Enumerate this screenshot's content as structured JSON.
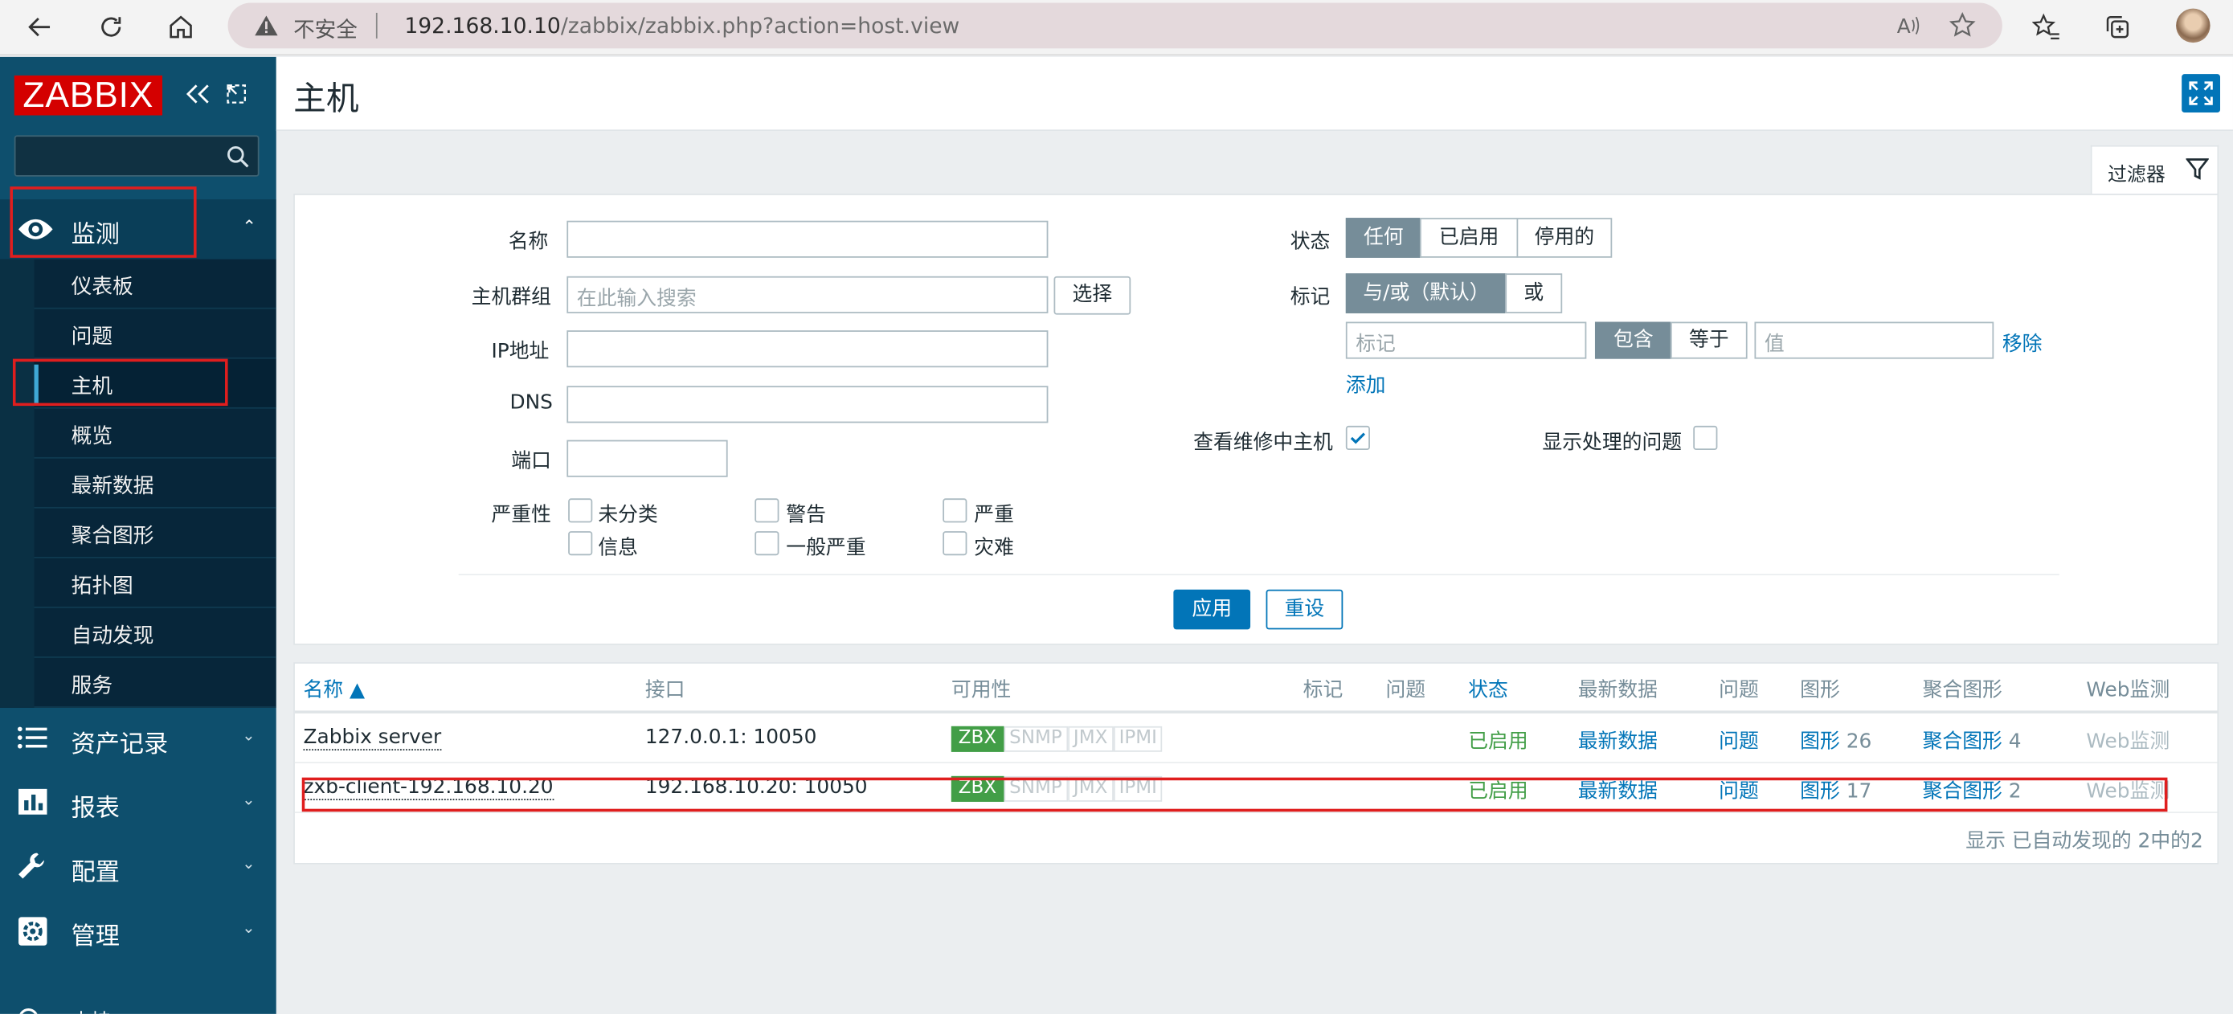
{
  "browser": {
    "insecure_label": "不安全",
    "url_host": "192.168.10.10",
    "url_path": "/zabbix/zabbix.php?action=host.view"
  },
  "sidebar": {
    "logo": "ZABBIX",
    "monitoring": {
      "label": "监测",
      "items": [
        "仪表板",
        "问题",
        "主机",
        "概览",
        "最新数据",
        "聚合图形",
        "拓扑图",
        "自动发现",
        "服务"
      ],
      "active_index": 2
    },
    "menus": [
      {
        "label": "资产记录",
        "icon": "list-icon"
      },
      {
        "label": "报表",
        "icon": "bar-chart-icon"
      },
      {
        "label": "配置",
        "icon": "wrench-icon"
      },
      {
        "label": "管理",
        "icon": "gear-icon"
      }
    ],
    "partial_bottom": "支持"
  },
  "page": {
    "title": "主机"
  },
  "filter": {
    "tab_label": "过滤器",
    "name_label": "名称",
    "hostgroup_label": "主机群组",
    "hostgroup_placeholder": "在此输入搜索",
    "select_btn": "选择",
    "ip_label": "IP地址",
    "dns_label": "DNS",
    "port_label": "端口",
    "severity_label": "严重性",
    "severities": [
      "未分类",
      "警告",
      "严重",
      "信息",
      "一般严重",
      "灾难"
    ],
    "status_label": "状态",
    "status_options": [
      "任何",
      "已启用",
      "停用的"
    ],
    "status_selected": "任何",
    "tags_label": "标记",
    "tag_mode_options": [
      "与/或（默认）",
      "或"
    ],
    "tag_placeholder": "标记",
    "tag_op_options": [
      "包含",
      "等于"
    ],
    "value_placeholder": "值",
    "remove_link": "移除",
    "add_link": "添加",
    "maintenance_label": "查看维修中主机",
    "maintenance_checked": true,
    "suppressed_label": "显示处理的问题",
    "suppressed_checked": false,
    "apply_btn": "应用",
    "reset_btn": "重设"
  },
  "table": {
    "columns": [
      "名称 ▲",
      "接口",
      "可用性",
      "标记",
      "问题",
      "状态",
      "最新数据",
      "问题",
      "图形",
      "聚合图形",
      "Web监测"
    ],
    "rows": [
      {
        "name": "Zabbix server",
        "interface": "127.0.0.1: 10050",
        "avail": [
          "ZBX",
          "SNMP",
          "JMX",
          "IPMI"
        ],
        "status": "已启用",
        "latest": "最新数据",
        "problems": "问题",
        "graphs": "图形",
        "graphs_count": "26",
        "screens": "聚合图形",
        "screens_count": "4",
        "web": "Web监测"
      },
      {
        "name": "zxb-client-192.168.10.20",
        "interface": "192.168.10.20: 10050",
        "avail": [
          "ZBX",
          "SNMP",
          "JMX",
          "IPMI"
        ],
        "status": "已启用",
        "latest": "最新数据",
        "problems": "问题",
        "graphs": "图形",
        "graphs_count": "17",
        "screens": "聚合图形",
        "screens_count": "2",
        "web": "Web监测"
      }
    ],
    "footer": "显示 已自动发现的 2中的2"
  }
}
